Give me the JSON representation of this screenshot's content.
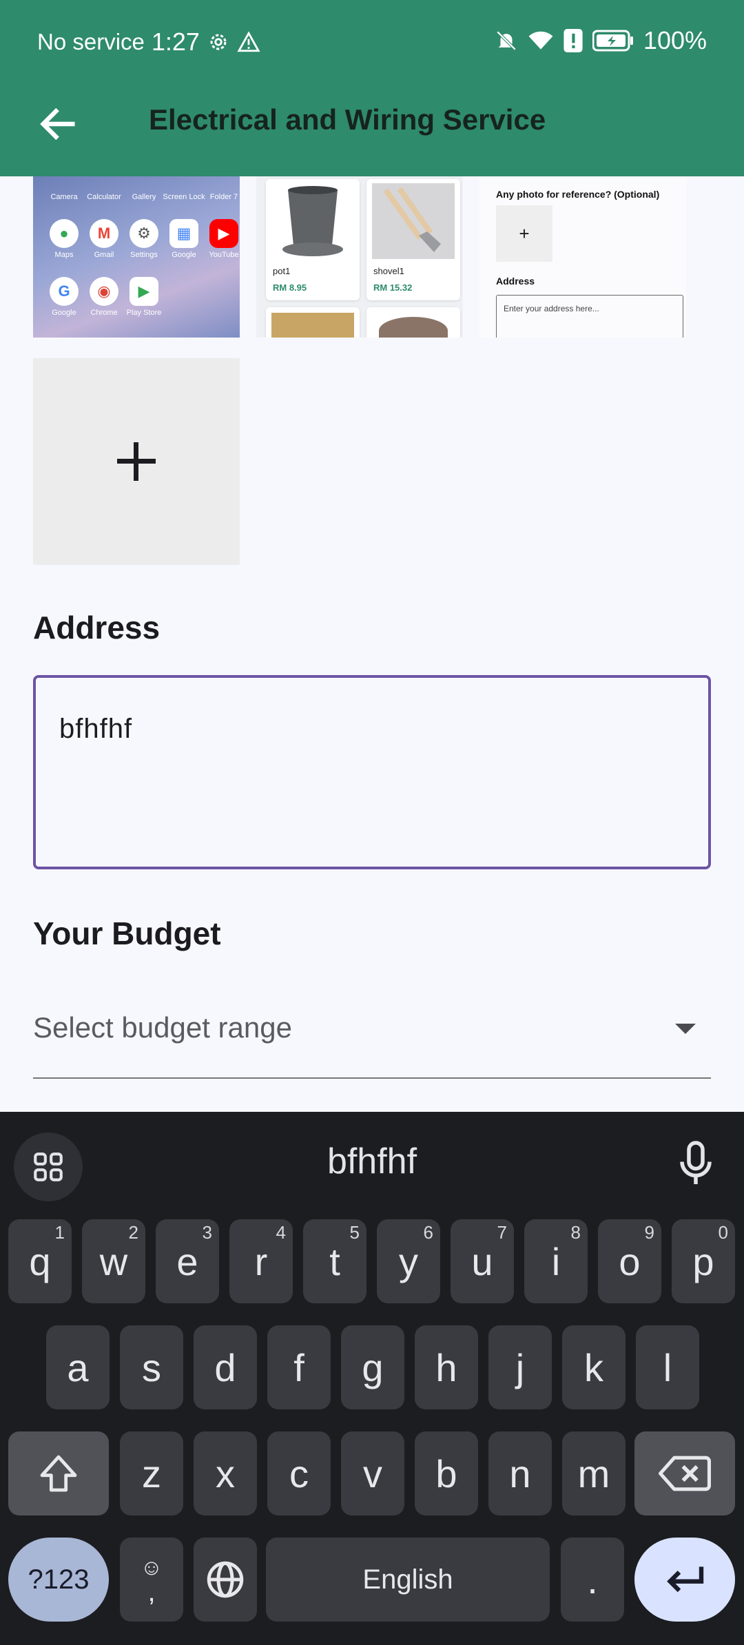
{
  "status_bar": {
    "carrier": "No service",
    "time": "1:27",
    "battery": "100%"
  },
  "app_bar": {
    "title": "Electrical and Wiring Service"
  },
  "thumbnails": {
    "home_screen_apps": [
      {
        "label": "Camera"
      },
      {
        "label": "Calculator"
      },
      {
        "label": "Gallery"
      },
      {
        "label": "Screen Lock"
      },
      {
        "label": "Folder 7"
      },
      {
        "label": "Maps"
      },
      {
        "label": "Gmail"
      },
      {
        "label": "Settings"
      },
      {
        "label": "Google"
      },
      {
        "label": "YouTube"
      },
      {
        "label": "Google"
      },
      {
        "label": "Chrome"
      },
      {
        "label": "Play Store"
      }
    ],
    "shop": [
      {
        "name": "pot1",
        "price": "RM 8.95"
      },
      {
        "name": "shovel1",
        "price": "RM 15.32"
      }
    ],
    "form": {
      "photo_label": "Any photo for reference? (Optional)",
      "plus": "+",
      "address_label": "Address",
      "address_placeholder": "Enter your address here..."
    }
  },
  "form": {
    "address_label": "Address",
    "address_value": "bfhfhf",
    "budget_label": "Your Budget",
    "budget_placeholder": "Select budget range"
  },
  "keyboard": {
    "suggestion": "bfhfhf",
    "row1": [
      {
        "k": "q",
        "h": "1"
      },
      {
        "k": "w",
        "h": "2"
      },
      {
        "k": "e",
        "h": "3"
      },
      {
        "k": "r",
        "h": "4"
      },
      {
        "k": "t",
        "h": "5"
      },
      {
        "k": "y",
        "h": "6"
      },
      {
        "k": "u",
        "h": "7"
      },
      {
        "k": "i",
        "h": "8"
      },
      {
        "k": "o",
        "h": "9"
      },
      {
        "k": "p",
        "h": "0"
      }
    ],
    "row2": [
      "a",
      "s",
      "d",
      "f",
      "g",
      "h",
      "j",
      "k",
      "l"
    ],
    "row3": [
      "z",
      "x",
      "c",
      "v",
      "b",
      "n",
      "m"
    ],
    "symbols_label": "?123",
    "comma": ",",
    "space_label": "English",
    "period": ".",
    "colors": {
      "background": "#1c1d21",
      "key": "#3a3b40",
      "accent_key": "#a9b7d6",
      "enter_key": "#d9e3ff"
    }
  },
  "colors": {
    "app_bar": "#2e8b6b",
    "focus_border": "#6d54a5",
    "page_bg": "#f7f8fd"
  }
}
